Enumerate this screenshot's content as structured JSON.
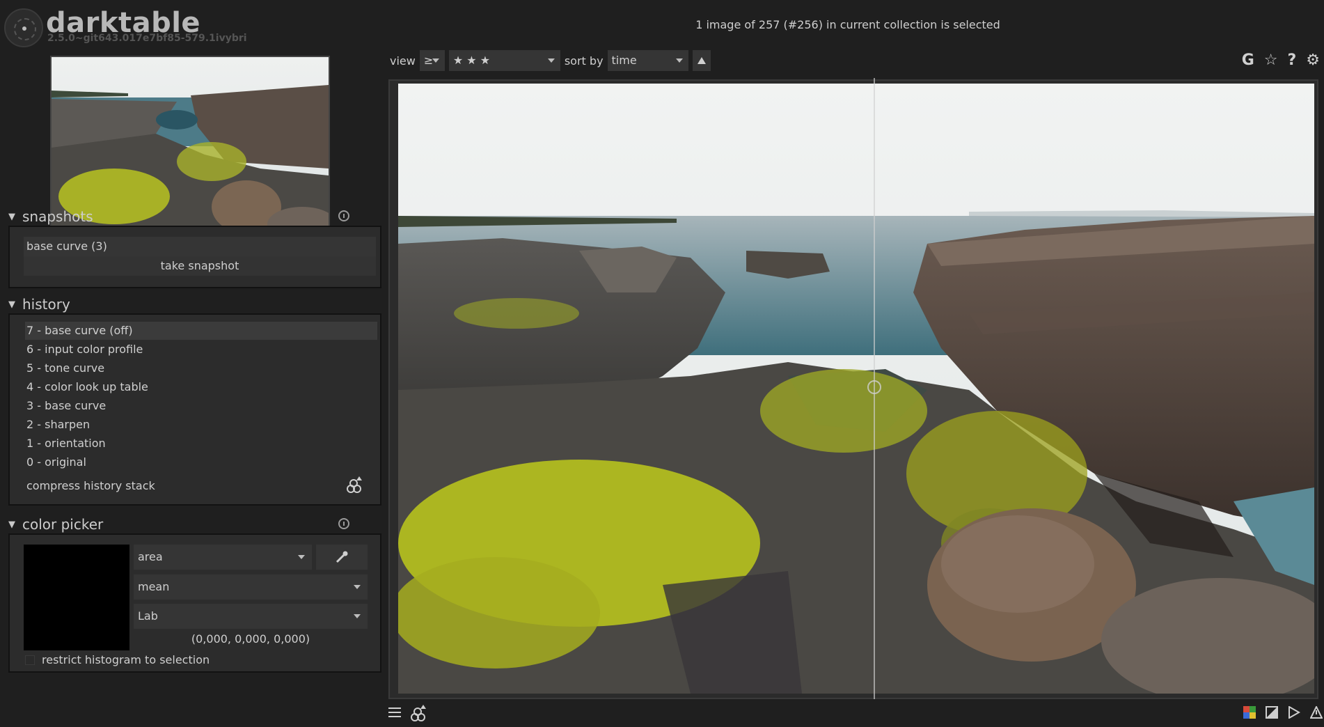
{
  "app": {
    "name": "darktable",
    "version": "2.5.0~git643.017e7bf85-579.1ivybri"
  },
  "header": {
    "collection_status": "1 image of 257 (#256) in current collection is selected"
  },
  "filter_bar": {
    "view_label": "view",
    "comparator": "≥",
    "rating": "★ ★ ★",
    "sort_label": "sort by",
    "sort_value": "time"
  },
  "top_right_icons": [
    "grouping-icon",
    "star-icon",
    "help-icon",
    "gear-icon"
  ],
  "top_right_glyphs": {
    "grouping": "G",
    "star": "☆",
    "help": "?",
    "gear": "⚙"
  },
  "snapshots": {
    "title": "snapshots",
    "items": [
      "base curve (3)"
    ],
    "take_snapshot_label": "take snapshot"
  },
  "history": {
    "title": "history",
    "items": [
      "7 - base curve   (off)",
      "6 - input color profile",
      "5 - tone curve",
      "4 - color look up table",
      "3 - base curve",
      "2 - sharpen",
      "1 - orientation",
      "0 - original"
    ],
    "compress_label": "compress history stack"
  },
  "color_picker": {
    "title": "color picker",
    "mode": "area",
    "statistic": "mean",
    "color_space": "Lab",
    "values": "(0,000, 0,000, 0,000)",
    "restrict_label": "restrict histogram to selection",
    "swatch_color": "#000000"
  },
  "colors": {
    "background": "#1f1f1f",
    "panel": "#2c2c2c",
    "accent": "#cfcfcf"
  }
}
